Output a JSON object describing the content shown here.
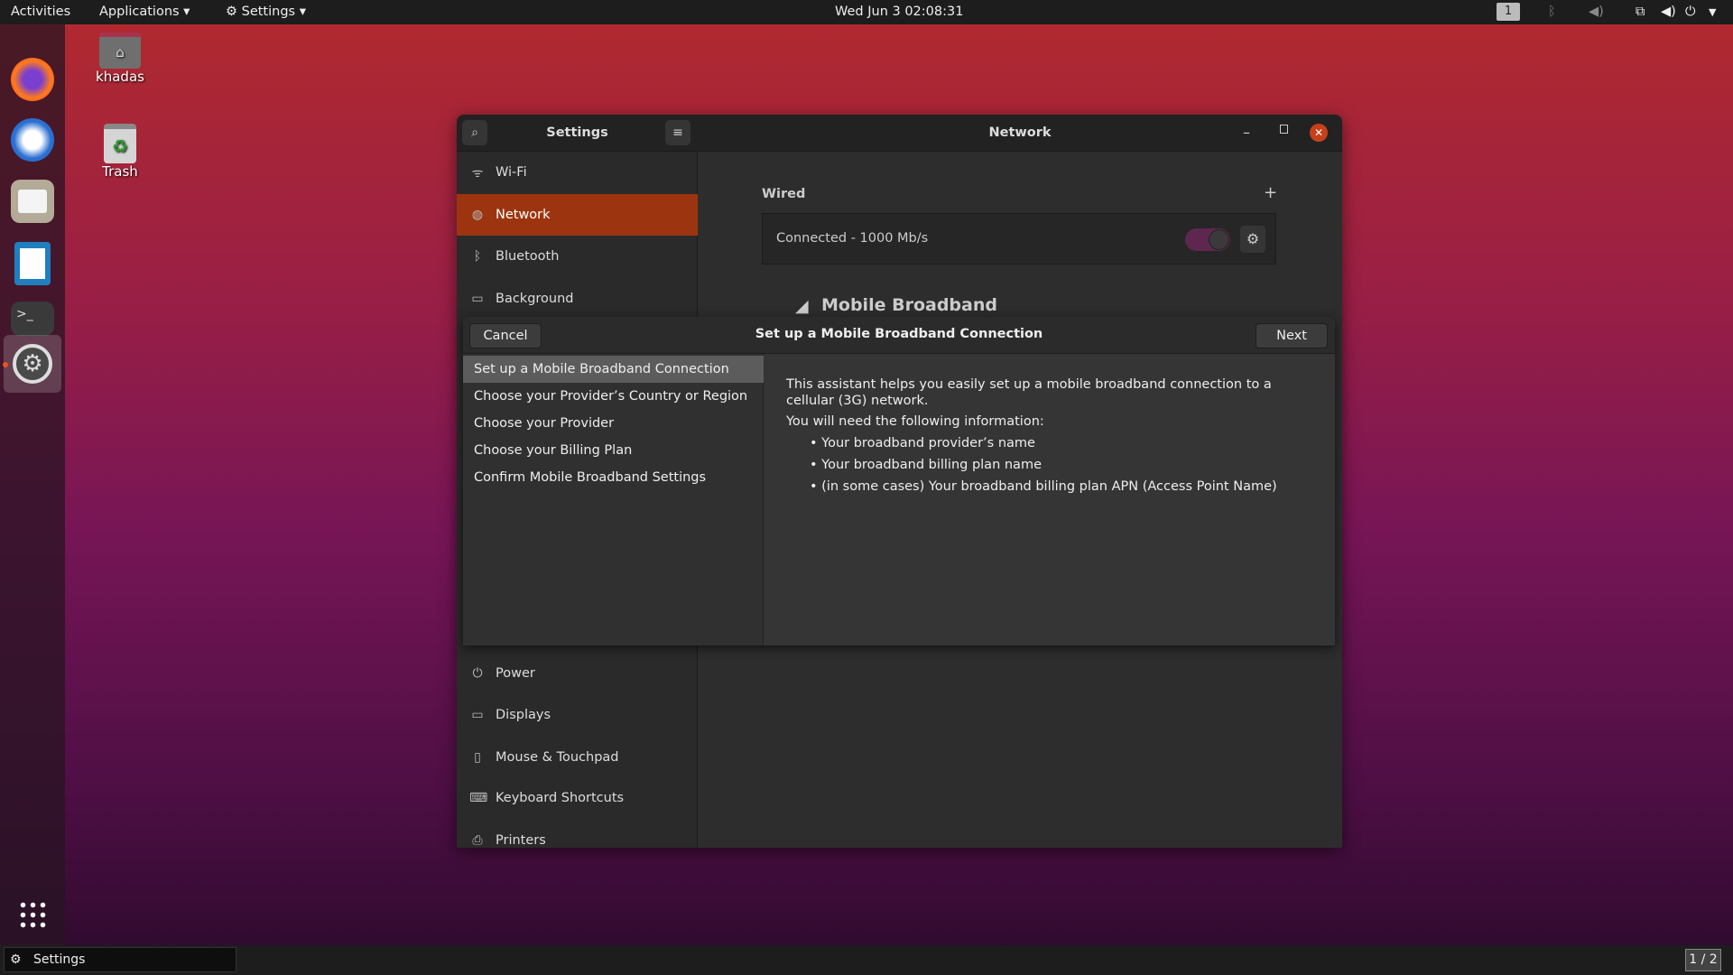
{
  "topbar": {
    "activities": "Activities",
    "applications": "Applications ▾",
    "settings_menu": "Settings ▾",
    "clock": "Wed Jun 3  02:08:31",
    "workspace": "1"
  },
  "desktop": {
    "home_label": "khadas",
    "trash_label": "Trash"
  },
  "taskbar": {
    "window_label": "Settings",
    "pager": "1 / 2"
  },
  "settings": {
    "title": "Settings",
    "page_title": "Network",
    "sidebar": [
      {
        "label": "Wi-Fi",
        "icon": "wifi-icon"
      },
      {
        "label": "Network",
        "icon": "globe-icon"
      },
      {
        "label": "Bluetooth",
        "icon": "bluetooth-icon"
      },
      {
        "label": "Background",
        "icon": "background-icon"
      },
      {
        "label": "Power",
        "icon": "power-icon"
      },
      {
        "label": "Displays",
        "icon": "display-icon"
      },
      {
        "label": "Mouse & Touchpad",
        "icon": "mouse-icon"
      },
      {
        "label": "Keyboard Shortcuts",
        "icon": "keyboard-icon"
      },
      {
        "label": "Printers",
        "icon": "printer-icon"
      }
    ],
    "wired": {
      "heading": "Wired",
      "status": "Connected - 1000 Mb/s",
      "enabled": true
    },
    "mobile_heading": "Mobile Broadband"
  },
  "dialog": {
    "title": "Set up a Mobile Broadband Connection",
    "cancel": "Cancel",
    "next": "Next",
    "steps": [
      "Set up a Mobile Broadband Connection",
      "Choose your Provider’s Country or Region",
      "Choose your Provider",
      "Choose your Billing Plan",
      "Confirm Mobile Broadband Settings"
    ],
    "intro": "This assistant helps you easily set up a mobile broadband connection to a cellular (3G) network.",
    "need": "You will need the following information:",
    "bullets": [
      "• Your broadband provider’s name",
      "• Your broadband billing plan name",
      "• (in some cases) Your broadband billing plan APN (Access Point Name)"
    ]
  },
  "colors": {
    "accent": "#9c350f",
    "close": "#c7401a",
    "toggle": "#5e2750"
  }
}
